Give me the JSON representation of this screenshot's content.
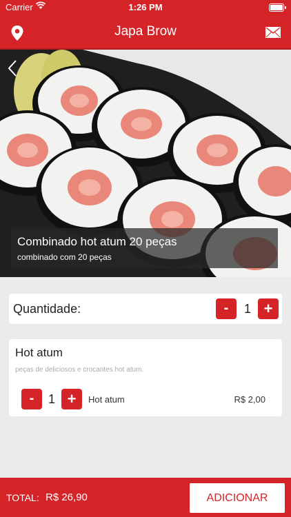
{
  "status_bar": {
    "carrier": "Carrier",
    "time": "1:26 PM"
  },
  "nav": {
    "title": "Japa Brow",
    "left_icon": "location-pin-icon",
    "right_icon": "mail-icon"
  },
  "product": {
    "name": "Combinado hot atum 20 peças",
    "description": "combinado com 20 peças"
  },
  "quantity": {
    "label": "Quantidade:",
    "minus_label": "-",
    "value": "1",
    "plus_label": "+"
  },
  "item_group": {
    "title": "Hot atum",
    "description": "peças de deliciosos e crocantes hot atum.",
    "options": [
      {
        "minus_label": "-",
        "quantity": "1",
        "plus_label": "+",
        "name": "Hot atum",
        "price": "R$ 2,00"
      }
    ]
  },
  "footer": {
    "total_label": "TOTAL:",
    "total_value": "R$ 26,90",
    "add_button_label": "ADICIONAR"
  },
  "colors": {
    "brand_red": "#d42427",
    "background": "#ebebeb"
  }
}
